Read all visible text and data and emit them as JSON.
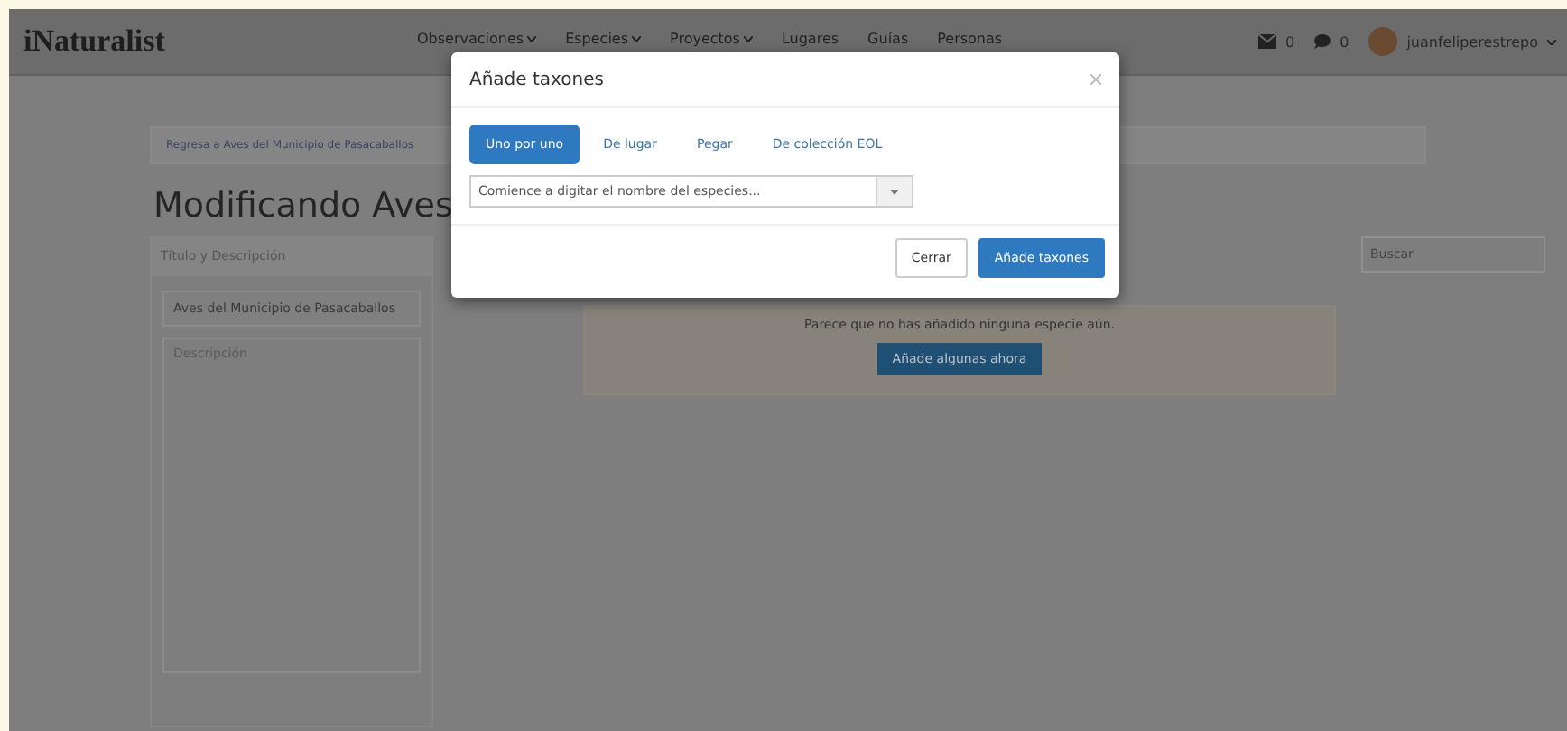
{
  "header": {
    "logo": "iNaturalist",
    "nav": [
      {
        "label": "Observaciones",
        "dropdown": true
      },
      {
        "label": "Especies",
        "dropdown": true
      },
      {
        "label": "Proyectos",
        "dropdown": true
      },
      {
        "label": "Lugares",
        "dropdown": false
      },
      {
        "label": "Guías",
        "dropdown": false
      },
      {
        "label": "Personas",
        "dropdown": false
      }
    ],
    "messages_count": "0",
    "notifications_count": "0",
    "user": "juanfeliperestrepo"
  },
  "breadcrumb": "Regresa a Aves del Municipio de Pasacaballos",
  "page_title": "Modificando Aves",
  "details_panel": {
    "title": "Título y Descripción",
    "title_value": "Aves del Municipio de Pasacaballos",
    "description_placeholder": "Descripción"
  },
  "search": {
    "placeholder": "Buscar"
  },
  "empty_notice": {
    "message": "Parece que no has añadido ninguna especie aún.",
    "button": "Añade algunas ahora"
  },
  "modal": {
    "title": "Añade taxones",
    "tabs": [
      {
        "label": "Uno por uno",
        "selected": true
      },
      {
        "label": "De lugar",
        "selected": false
      },
      {
        "label": "Pegar",
        "selected": false
      },
      {
        "label": "De colección EOL",
        "selected": false
      }
    ],
    "taxon_input": {
      "placeholder": "Comience a digitar el nombre del especies..."
    },
    "buttons": [
      {
        "label": "Cerrar",
        "kind": "secondary"
      },
      {
        "label": "Añade taxones",
        "kind": "primary"
      }
    ]
  }
}
